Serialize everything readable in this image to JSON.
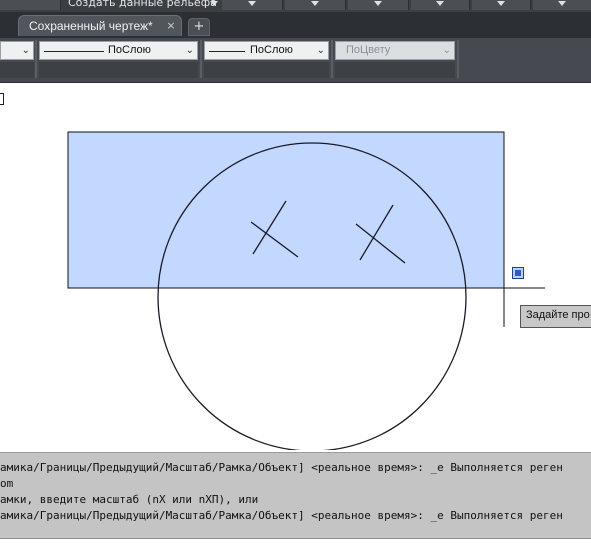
{
  "ribbon": {
    "panel_label": "Создать данные рельефа"
  },
  "tabs": [
    {
      "label": "Сохраненный чертеж*",
      "close": "×"
    }
  ],
  "new_tab": "+",
  "properties": {
    "layer": {
      "value": ""
    },
    "linetype": {
      "value": "ПоСлою"
    },
    "lineweight": {
      "value": "ПоСлою"
    },
    "plotstyle": {
      "value": "ПоЦвету"
    }
  },
  "drawing": {
    "selection_color": "#c2d8ff",
    "tooltip": "Задайте про"
  },
  "command_window": {
    "lines": [
      "амика/Границы/Предыдущий/Масштаб/Рамка/Объект] <реальное время>: _e Выполняется реген",
      "om",
      "амки, введите масштаб (nX или nXП), или",
      "амика/Границы/Предыдущий/Масштаб/Рамка/Объект] <реальное время>: _e Выполняется реген"
    ]
  }
}
